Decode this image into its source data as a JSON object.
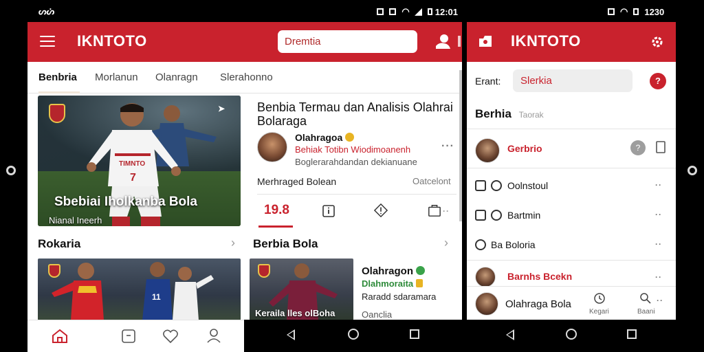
{
  "left_status": {
    "left_text": "ᔕᔖ",
    "time": "12:01"
  },
  "right_status": {
    "time": "1230"
  },
  "left": {
    "app_title": "IKNTOTO",
    "search_value": "Dremtia",
    "tabs": [
      {
        "label": "Benbria"
      },
      {
        "label": "Morlanun"
      },
      {
        "label": "Olanragn"
      },
      {
        "label": "Slerahonno"
      }
    ],
    "hero": {
      "title": "Sbebiai Iholkanba Bola",
      "subtitle": "Nianal Ineerh",
      "jersey_text": "TIMNTO",
      "number": "7"
    },
    "article": {
      "title": "Benbia Termau dan Analisis Olahrai Bolaraga",
      "author": "Olahragoa",
      "line2": "Behiak Totibn Wiodimoanenh",
      "line3": "Boglerarahdandan dekianuane",
      "row_label": "Merhraged Bolean",
      "row_right": "Oatcelont",
      "count": "19.8"
    },
    "section1": "Rokaria",
    "section2": "Berbia Bola",
    "card_right": {
      "overlay": "Keraila lles olBoha",
      "title": "Olahragon",
      "subtitle": "Dlahmoraita",
      "line3": "Raradd sdaramara",
      "line4": "Oanclia"
    },
    "colors": {
      "brand": "#c9222d"
    }
  },
  "right": {
    "app_title": "IKNTOTO",
    "search_label": "Erant:",
    "search_value": "Slerkia",
    "section_title": "Berhia",
    "section_sub": "Taorak",
    "items": [
      {
        "label": "Gerbrio"
      },
      {
        "label": "Oolnstoul"
      },
      {
        "label": "Bartmin"
      },
      {
        "label": "Ba Boloria"
      },
      {
        "label": "Barnhs Bcekn"
      }
    ],
    "bottom": {
      "name": "Olahraga Bola",
      "lbl1": "Kegari",
      "lbl2": "Baani"
    }
  }
}
